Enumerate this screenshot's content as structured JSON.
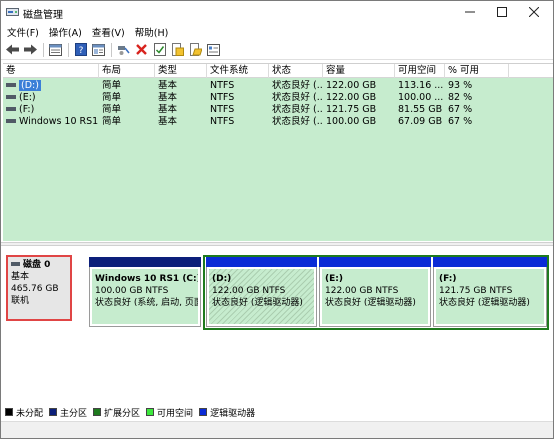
{
  "window": {
    "title": "磁盘管理"
  },
  "menu": [
    {
      "label": "文件(F)"
    },
    {
      "label": "操作(A)"
    },
    {
      "label": "查看(V)"
    },
    {
      "label": "帮助(H)"
    }
  ],
  "toolbar": [
    {
      "icon": "back-arrow-icon"
    },
    {
      "icon": "forward-arrow-icon"
    },
    {
      "icon": "list-view-icon"
    },
    {
      "icon": "help-icon"
    },
    {
      "icon": "details-view-icon"
    },
    {
      "icon": "connect-icon"
    },
    {
      "icon": "delete-icon"
    },
    {
      "icon": "check-icon"
    },
    {
      "icon": "folder-icon"
    },
    {
      "icon": "folder-open-icon"
    },
    {
      "icon": "properties-icon"
    }
  ],
  "volume_table": {
    "columns": [
      "卷",
      "布局",
      "类型",
      "文件系统",
      "状态",
      "容量",
      "可用空间",
      "% 可用"
    ],
    "rows": [
      {
        "volume": "(D:)",
        "layout": "简单",
        "type": "基本",
        "fs": "NTFS",
        "status": "状态良好 (...",
        "capacity": "122.00 GB",
        "free": "113.16 ...",
        "pct": "93 %",
        "selected": true
      },
      {
        "volume": "(E:)",
        "layout": "简单",
        "type": "基本",
        "fs": "NTFS",
        "status": "状态良好 (...",
        "capacity": "122.00 GB",
        "free": "100.00 ...",
        "pct": "82 %",
        "selected": false
      },
      {
        "volume": "(F:)",
        "layout": "简单",
        "type": "基本",
        "fs": "NTFS",
        "status": "状态良好 (...",
        "capacity": "121.75 GB",
        "free": "81.55 GB",
        "pct": "67 %",
        "selected": false
      },
      {
        "volume": "Windows 10 RS1...",
        "layout": "简单",
        "type": "基本",
        "fs": "NTFS",
        "status": "状态良好 (...",
        "capacity": "100.00 GB",
        "free": "67.09 GB",
        "pct": "67 %",
        "selected": false
      }
    ]
  },
  "disk": {
    "name": "磁盘 0",
    "type": "基本",
    "size": "465.76 GB",
    "state": "联机"
  },
  "partitions": [
    {
      "title": "Windows 10 RS1  (C:)",
      "size": "100.00 GB NTFS",
      "status": "状态良好 (系统, 启动, 页面",
      "kind": "primary"
    },
    {
      "title": "(D:)",
      "size": "122.00 GB NTFS",
      "status": "状态良好 (逻辑驱动器)",
      "kind": "logical-selected"
    },
    {
      "title": "(E:)",
      "size": "122.00 GB NTFS",
      "status": "状态良好 (逻辑驱动器)",
      "kind": "logical"
    },
    {
      "title": "(F:)",
      "size": "121.75 GB NTFS",
      "status": "状态良好 (逻辑驱动器)",
      "kind": "logical"
    }
  ],
  "legend": [
    {
      "label": "未分配",
      "color": "#000000"
    },
    {
      "label": "主分区",
      "color": "#0c1f7a"
    },
    {
      "label": "扩展分区",
      "color": "#1e7a1e"
    },
    {
      "label": "可用空间",
      "color": "#3ce83c"
    },
    {
      "label": "逻辑驱动器",
      "color": "#0a2bd6"
    }
  ],
  "colors": {
    "primary_cap": "#0c1f7a",
    "logical_cap": "#0a2bd6",
    "extended_frame": "#1e7a1e",
    "volume_bg": "#c6ecce",
    "disk_highlight": "#e04545"
  }
}
